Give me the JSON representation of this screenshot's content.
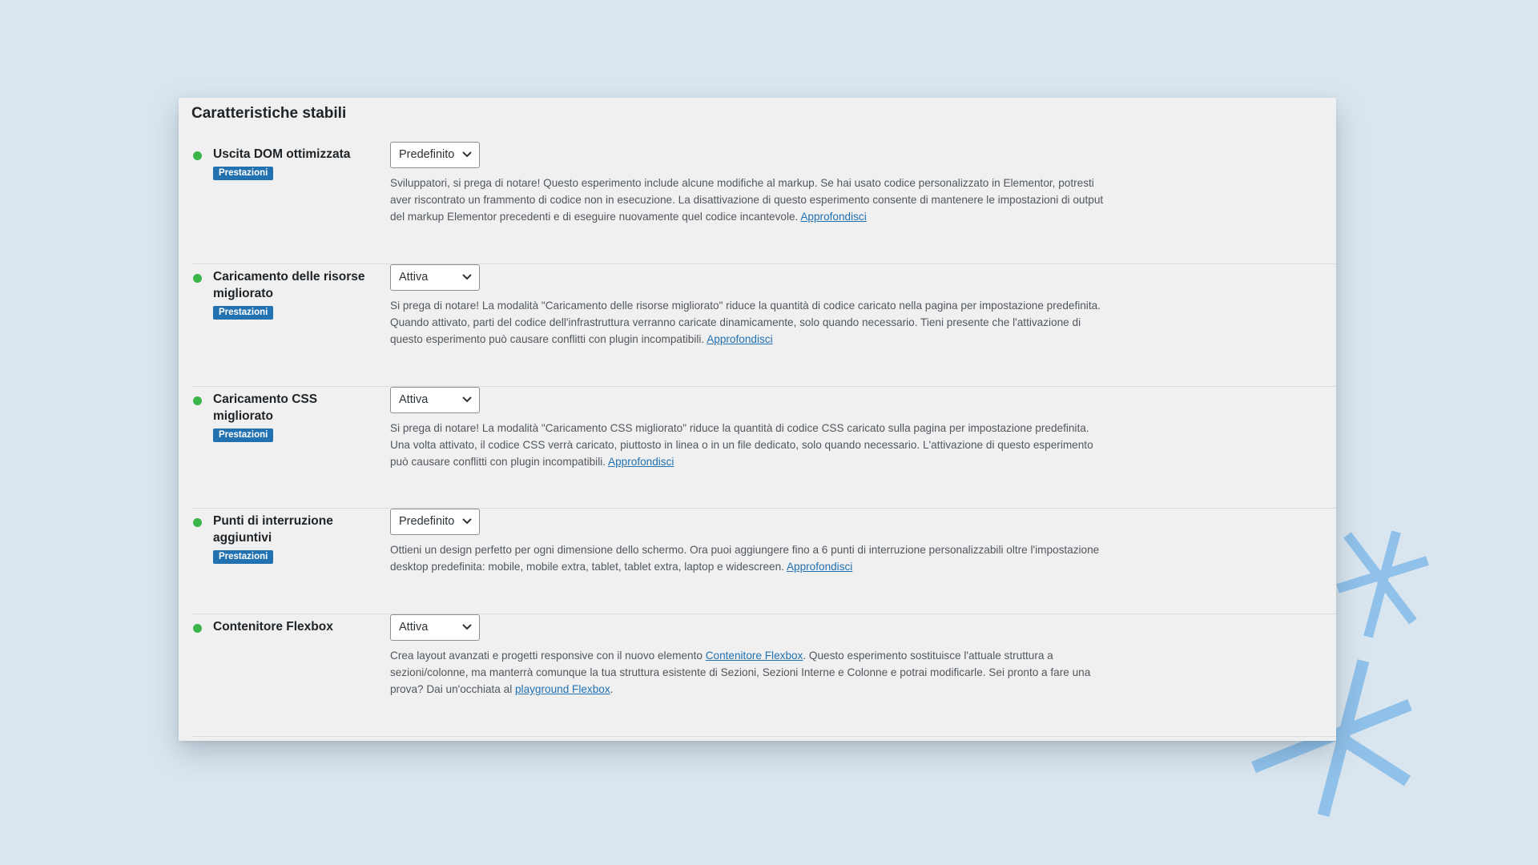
{
  "section": {
    "title": "Caratteristiche stabili"
  },
  "colors": {
    "background": "#dae6ef",
    "card": "#f0f0f1",
    "active_dot": "#39b54a",
    "tag": "#2271b1",
    "link": "#2271b1"
  },
  "experiments": [
    {
      "name": "Uscita DOM ottimizzata",
      "tag": "Prestazioni",
      "status_icon": "green-dot-icon",
      "selected": "Predefinito",
      "description": "Sviluppatori, si prega di notare! Questo esperimento include alcune modifiche al markup. Se hai usato codice personalizzato in Elementor, potresti aver riscontrato un frammento di codice non in esecuzione. La disattivazione di questo esperimento consente di mantenere le impostazioni di output del markup Elementor precedenti e di eseguire nuovamente quel codice incantevole.",
      "link": "Approfondisci",
      "after": ""
    },
    {
      "name": "Caricamento delle risorse migliorato",
      "tag": "Prestazioni",
      "status_icon": "green-dot-icon",
      "selected": "Attiva",
      "description": "Si prega di notare! La modalità \"Caricamento delle risorse migliorato\" riduce la quantità di codice caricato nella pagina per impostazione predefinita. Quando attivato, parti del codice dell'infrastruttura verranno caricate dinamicamente, solo quando necessario. Tieni presente che l'attivazione di questo esperimento può causare conflitti con plugin incompatibili.",
      "link": "Approfondisci",
      "after": ""
    },
    {
      "name": "Caricamento CSS migliorato",
      "tag": "Prestazioni",
      "status_icon": "green-dot-icon",
      "selected": "Attiva",
      "description": "Si prega di notare! La modalità \"Caricamento CSS migliorato\" riduce la quantità di codice CSS caricato sulla pagina per impostazione predefinita. Una volta attivato, il codice CSS verrà caricato, piuttosto in linea o in un file dedicato, solo quando necessario. L'attivazione di questo esperimento può causare conflitti con plugin incompatibili.",
      "link": "Approfondisci",
      "after": ""
    },
    {
      "name": "Punti di interruzione aggiuntivi",
      "tag": "Prestazioni",
      "status_icon": "green-dot-icon",
      "selected": "Predefinito",
      "description": "Ottieni un design perfetto per ogni dimensione dello schermo. Ora puoi aggiungere fino a 6 punti di interruzione personalizzabili oltre l'impostazione desktop predefinita: mobile, mobile extra, tablet, tablet extra, laptop e widescreen.",
      "link": "Approfondisci",
      "after": ""
    },
    {
      "name": "Contenitore Flexbox",
      "tag": "",
      "status_icon": "green-dot-icon",
      "selected": "Attiva",
      "description_parts": [
        "Crea layout avanzati e progetti responsive con il nuovo elemento ",
        "Contenitore Flexbox",
        ". Questo esperimento sostituisce l'attuale struttura a sezioni/colonne, ma manterrà comunque la tua struttura esistente di Sezioni, Sezioni Interne e Colonne e potrai modificarle. Sei pronto a fare una prova? Dai un'occhiata al ",
        "playground Flexbox",
        "."
      ]
    }
  ]
}
